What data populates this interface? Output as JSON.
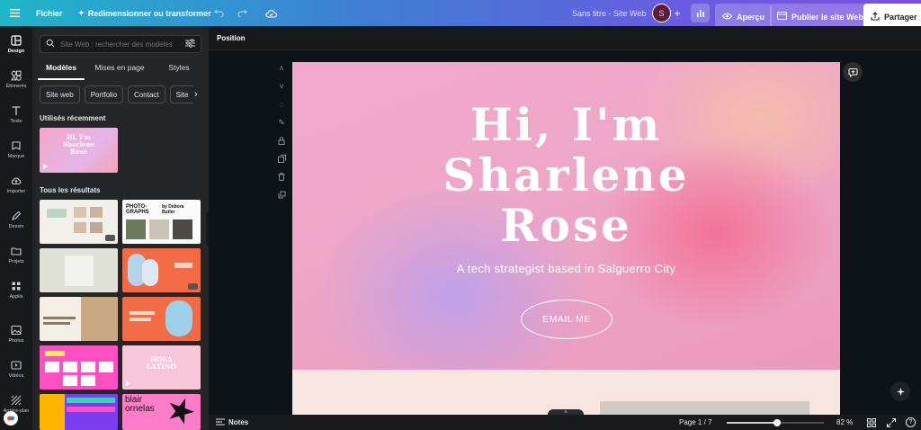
{
  "topbar": {
    "menu_icon": "hamburger-icon",
    "file_label": "Fichier",
    "resize_label": "Redimensionner ou transformer",
    "doc_title": "Sans titre - Site Web",
    "avatar_letter": "S",
    "preview_label": "Aperçu",
    "publish_label": "Publier le site Web",
    "share_label": "Partager"
  },
  "rail": {
    "items": [
      {
        "label": "Design",
        "icon": "design-icon"
      },
      {
        "label": "Éléments",
        "icon": "elements-icon"
      },
      {
        "label": "Texte",
        "icon": "text-icon"
      },
      {
        "label": "Marque",
        "icon": "brand-icon"
      },
      {
        "label": "Importer",
        "icon": "upload-icon"
      },
      {
        "label": "Dessin",
        "icon": "draw-icon"
      },
      {
        "label": "Projets",
        "icon": "folder-icon"
      },
      {
        "label": "Applis",
        "icon": "apps-icon"
      },
      {
        "label": "Photos",
        "icon": "photos-icon"
      },
      {
        "label": "Vidéos",
        "icon": "videos-icon"
      },
      {
        "label": "Arrière-plan",
        "icon": "background-icon"
      }
    ]
  },
  "panel": {
    "search_placeholder": "Site Web : rechercher des modèles",
    "tabs": [
      "Modèles",
      "Mises en page",
      "Styles"
    ],
    "chips": [
      "Site web",
      "Portfolio",
      "Contact",
      "Site"
    ],
    "recent_label": "Utilisés récemment",
    "all_label": "Tous les résultats",
    "recent_thumb_text": "Hi, I'm Sharlene Rose",
    "result_texts": {
      "photographs": "PHOTO-GRAPHS",
      "by": "by Debora Butler",
      "blair": "blair ornelas",
      "hola": "HOLA LATINO"
    }
  },
  "canvas": {
    "position_label": "Position",
    "hero_line1": "Hi, I'm",
    "hero_line2": "Sharlene",
    "hero_line3": "Rose",
    "tagline": "A tech strategist based in Salguerro City",
    "email_button": "EMAIL ME"
  },
  "status": {
    "notes_label": "Notes",
    "page_label": "Page 1 / 7",
    "zoom_label": "82 %",
    "zoom_value": 82
  },
  "colors": {
    "accent": "#7b4fe2",
    "panel_bg": "#252627",
    "rail_bg": "#18191b"
  }
}
